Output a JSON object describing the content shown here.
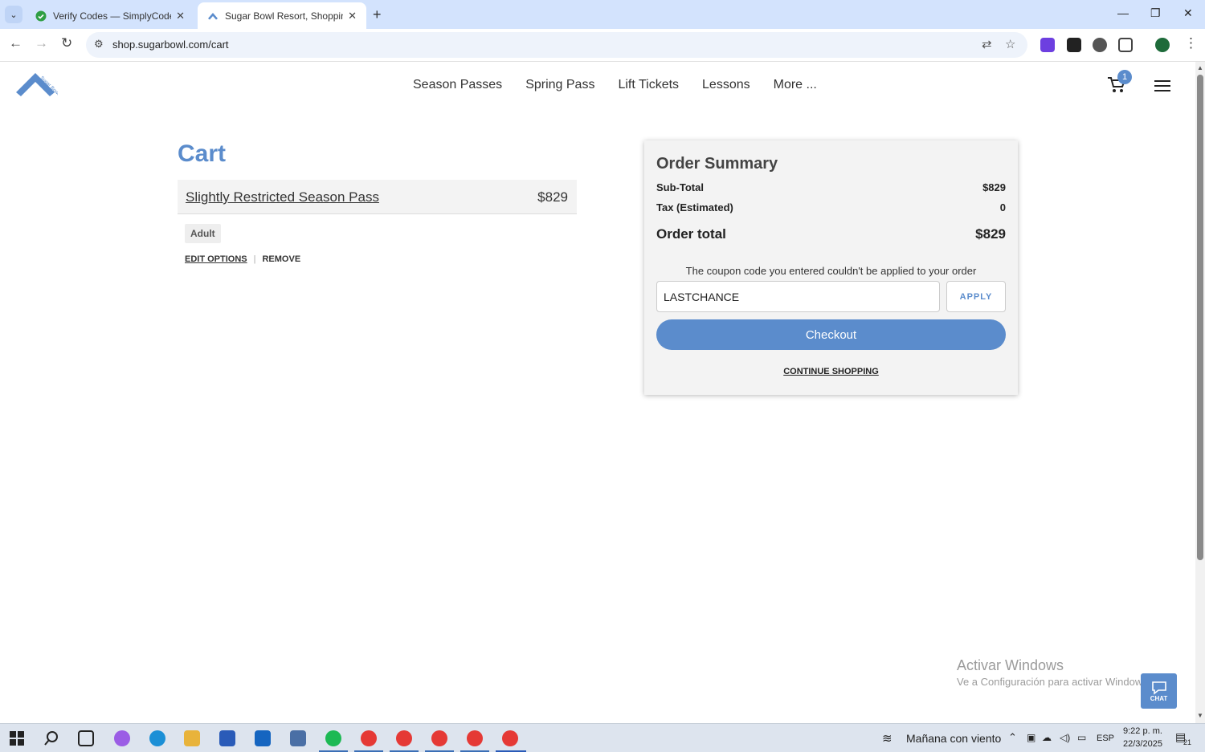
{
  "browser": {
    "tabs": [
      {
        "title": "Verify Codes — SimplyCodes"
      },
      {
        "title": "Sugar Bowl Resort, Shopping C"
      }
    ],
    "url": "shop.sugarbowl.com/cart"
  },
  "site": {
    "logo_text": "Sugar Bowl",
    "nav": [
      "Season Passes",
      "Spring Pass",
      "Lift Tickets",
      "Lessons",
      "More ..."
    ],
    "cart_count": "1",
    "accent_color": "#5b8ccc"
  },
  "cart": {
    "title": "Cart",
    "item": {
      "name": "Slightly Restricted Season Pass",
      "price": "$829",
      "option": "Adult",
      "edit_label": "EDIT OPTIONS",
      "remove_label": "REMOVE"
    }
  },
  "summary": {
    "title": "Order Summary",
    "subtotal_label": "Sub-Total",
    "subtotal_value": "$829",
    "tax_label": "Tax (Estimated)",
    "tax_value": "0",
    "total_label": "Order total",
    "total_value": "$829",
    "coupon_message": "The coupon code you entered couldn't be applied to your order",
    "coupon_value": "LASTCHANCE",
    "apply_label": "APPLY",
    "checkout_label": "Checkout",
    "continue_label": "CONTINUE SHOPPING"
  },
  "overlay": {
    "activate_title": "Activar Windows",
    "activate_sub": "Ve a Configuración para activar Windows.",
    "chat_label": "CHAT"
  },
  "taskbar": {
    "weather": "Mañana con viento",
    "lang": "ESP",
    "time": "9:22 p. m.",
    "date": "22/3/2025",
    "notifications": "21"
  }
}
